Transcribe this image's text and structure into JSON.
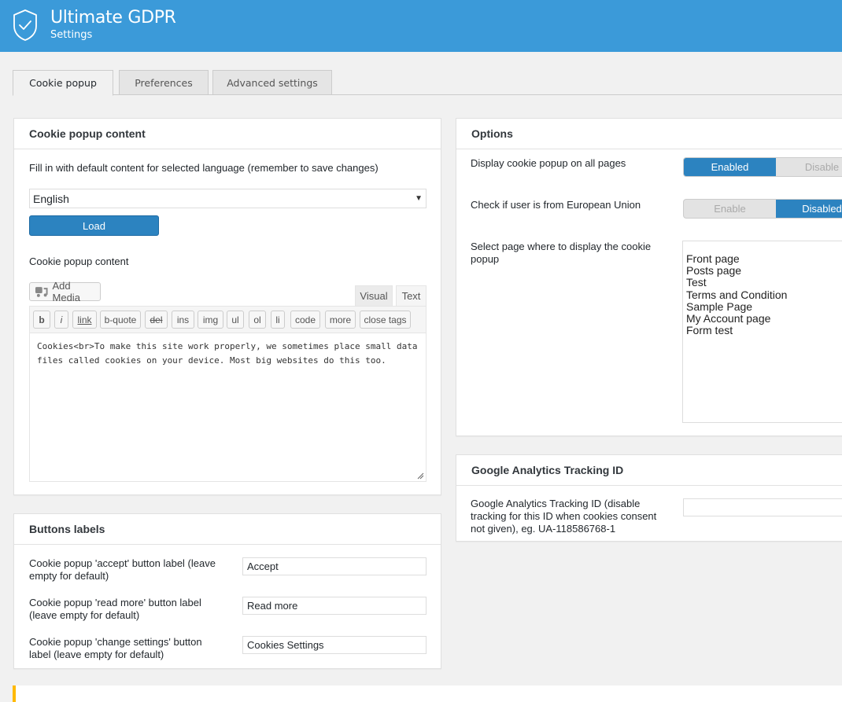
{
  "header": {
    "title": "Ultimate GDPR",
    "subtitle": "Settings",
    "logo_icon": "shield-check-icon",
    "color": "#3b9ad9"
  },
  "tabs": [
    {
      "label": "Cookie popup",
      "active": true
    },
    {
      "label": "Preferences",
      "active": false
    },
    {
      "label": "Advanced settings",
      "active": false
    }
  ],
  "cookie_content": {
    "title": "Cookie popup content",
    "hint": "Fill in with default content for selected language (remember to save changes)",
    "language_selected": "English",
    "load_label": "Load",
    "content_label": "Cookie popup content",
    "add_media_label": "Add Media",
    "editor_tabs": [
      "Visual",
      "Text"
    ],
    "editor_active": "Text",
    "toolbar": [
      "b",
      "i",
      "link",
      "b-quote",
      "del",
      "ins",
      "img",
      "ul",
      "ol",
      "li",
      "code",
      "more",
      "close tags"
    ],
    "content": "Cookies<br>To make this site work properly, we sometimes place small data files called cookies on your device. Most big websites do this too."
  },
  "buttons_labels": {
    "title": "Buttons labels",
    "rows": [
      {
        "label": "Cookie popup 'accept' button label (leave empty for default)",
        "value": "Accept"
      },
      {
        "label": "Cookie popup 'read more' button label (leave empty for default)",
        "value": "Read more"
      },
      {
        "label": "Cookie popup 'change settings' button label (leave empty for default)",
        "value": "Cookies Settings"
      }
    ]
  },
  "options": {
    "title": "Options",
    "display_all": {
      "label": "Display cookie popup on all pages",
      "on_label": "Enabled",
      "off_label": "Disable",
      "state": "enabled"
    },
    "eu_check": {
      "label": "Check if user is from European Union",
      "on_label": "Enable",
      "off_label": "Disabled",
      "state": "disabled"
    },
    "page_select": {
      "label": "Select page where to display the cookie popup",
      "options": [
        "Front page",
        "Posts page",
        "Test",
        "Terms and Condition",
        "Sample Page",
        "My Account page",
        "Form test"
      ]
    },
    "accent": "#2c83c0"
  },
  "analytics": {
    "title": "Google Analytics Tracking ID",
    "label": "Google Analytics Tracking ID (disable tracking for this ID when cookies consent not given), eg. UA-118586768-1",
    "value": ""
  }
}
